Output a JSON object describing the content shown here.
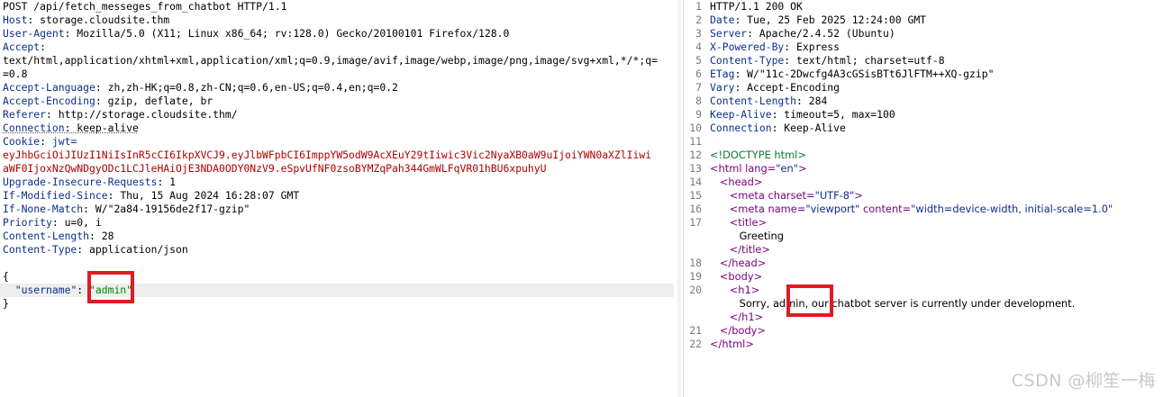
{
  "request": {
    "request_line": "POST /api/fetch_messeges_from_chatbot HTTP/1.1",
    "headers": [
      {
        "name": "Host",
        "value": "storage.cloudsite.thm"
      },
      {
        "name": "User-Agent",
        "value": "Mozilla/5.0 (X11; Linux x86_64; rv:128.0) Gecko/20100101 Firefox/128.0"
      },
      {
        "name": "Accept",
        "value": ""
      },
      {
        "name": "",
        "value": "text/html,application/xhtml+xml,application/xml;q=0.9,image/avif,image/webp,image/png,image/svg+xml,*/*;q="
      },
      {
        "name": "",
        "value": "=0.8"
      },
      {
        "name": "Accept-Language",
        "value": "zh,zh-HK;q=0.8,zh-CN;q=0.6,en-US;q=0.4,en;q=0.2"
      },
      {
        "name": "Accept-Encoding",
        "value": "gzip, deflate, br"
      },
      {
        "name": "Referer",
        "value": "http://storage.cloudsite.thm/"
      },
      {
        "name": "Connection",
        "value": "keep-alive"
      },
      {
        "name": "Cookie",
        "value": "jwt="
      }
    ],
    "cookie_lines": [
      "eyJhbGciOiJIUzI1NiIsInR5cCI6IkpXVCJ9.eyJlbWFpbCI6ImppYW5odW9AcXEuY29tIiwic3Vic2NyaXB0aW9uIjoiYWN0aXZlIiwi",
      "aWF0IjoxNzQwNDgyODc1LCJleHAiOjE3NDA0ODY0NzV9.eSpvUfNF0zsoBYMZqPah344GmWLFqVR01hBU6xpuhyU"
    ],
    "headers2": [
      {
        "name": "Upgrade-Insecure-Requests",
        "value": "1"
      },
      {
        "name": "If-Modified-Since",
        "value": "Thu, 15 Aug 2024 16:28:07 GMT"
      },
      {
        "name": "If-None-Match",
        "value": "W/\"2a84-19156de2f17-gzip\""
      },
      {
        "name": "Priority",
        "value": "u=0, i"
      },
      {
        "name": "Content-Length",
        "value": "28"
      },
      {
        "name": "Content-Type",
        "value": "application/json"
      }
    ],
    "body_open": "{",
    "body_key": "\"username\"",
    "body_colon": ":",
    "body_value": "\"admin\"",
    "body_close": "}"
  },
  "response": {
    "line_numbers": [
      "1",
      "2",
      "3",
      "4",
      "5",
      "6",
      "7",
      "8",
      "9",
      "10",
      "11",
      "12",
      "13",
      "14",
      "15",
      "16",
      "17",
      "",
      "",
      "18",
      "19",
      "20",
      "",
      "",
      "21",
      "22"
    ],
    "status": "HTTP/1.1 200 OK",
    "headers": [
      {
        "name": "Date",
        "value": "Tue, 25 Feb 2025 12:24:00 GMT"
      },
      {
        "name": "Server",
        "value": "Apache/2.4.52 (Ubuntu)"
      },
      {
        "name": "X-Powered-By",
        "value": "Express"
      },
      {
        "name": "Content-Type",
        "value": "text/html; charset=utf-8"
      },
      {
        "name": "ETag",
        "value": "W/\"11c-2Dwcfg4A3cGSisBTt6JlFTM++XQ-gzip\""
      },
      {
        "name": "Vary",
        "value": "Accept-Encoding"
      },
      {
        "name": "Content-Length",
        "value": "284"
      },
      {
        "name": "Keep-Alive",
        "value": "timeout=5, max=100"
      },
      {
        "name": "Connection",
        "value": "Keep-Alive"
      }
    ],
    "html": {
      "doctype": "<!DOCTYPE html>",
      "html_open": "<html",
      "lang_attr": "lang=",
      "lang_val": "\"en\"",
      "gt": ">",
      "head_open": "<head>",
      "meta1_open": "<meta",
      "charset_attr": "charset=",
      "charset_val": "\"UTF-8\"",
      "meta_close": ">",
      "meta2_open": "<meta",
      "name_attr": "name=",
      "name_val": "\"viewport\"",
      "content_attr": "content=",
      "content_val": "\"width=device-width, initial-scale=1.0\"",
      "title_open": "<title>",
      "title_text": "Greeting",
      "title_close": "</title>",
      "head_close": "</head>",
      "body_open": "<body>",
      "h1_open": "<h1>",
      "h1_before": "Sorry, ",
      "h1_name": "admin",
      "h1_after": ", our chatbot server is currently under development.",
      "h1_close": "</h1>",
      "body_close": "</body>",
      "html_close": "</html>"
    }
  },
  "watermark": "CSDN @柳笙一梅",
  "colors": {
    "highlight_box": "#e01b24",
    "header_name": "#0b2f8a",
    "cookie_value": "#b00000",
    "json_value": "#008a00",
    "tag": "#7a007a"
  }
}
